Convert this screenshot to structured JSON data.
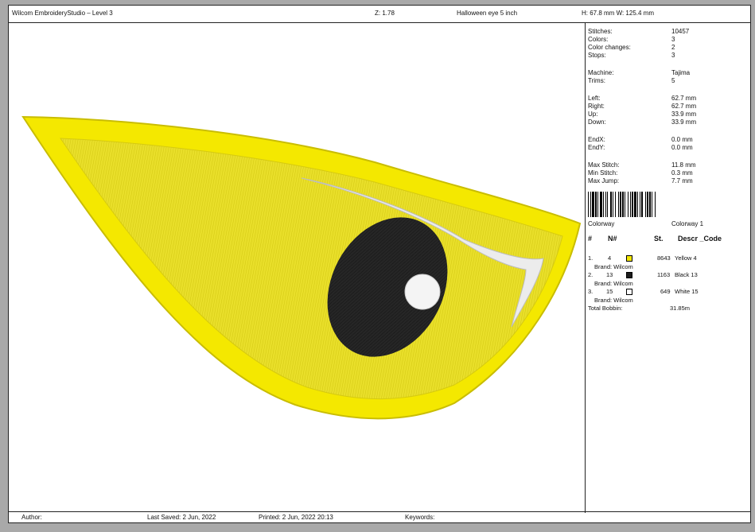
{
  "header": {
    "app_title": "Wilcom EmbroideryStudio – Level 3",
    "zoom": "Z: 1.78",
    "design_name": "Halloween eye 5 inch",
    "dimensions": "H: 67.8 mm  W: 125.4 mm"
  },
  "stats": [
    {
      "label": "Stitches:",
      "value": "10457"
    },
    {
      "label": "Colors:",
      "value": "3"
    },
    {
      "label": "Color changes:",
      "value": "2"
    },
    {
      "label": "Stops:",
      "value": "3"
    },
    {
      "label": "Machine:",
      "value": "Tajima"
    },
    {
      "label": "Trims:",
      "value": "5"
    },
    {
      "label": "Left:",
      "value": "62.7 mm"
    },
    {
      "label": "Right:",
      "value": "62.7 mm"
    },
    {
      "label": "Up:",
      "value": "33.9 mm"
    },
    {
      "label": "Down:",
      "value": "33.9 mm"
    },
    {
      "label": "EndX:",
      "value": "0.0 mm"
    },
    {
      "label": "EndY:",
      "value": "0.0 mm"
    },
    {
      "label": "Max Stitch:",
      "value": "11.8 mm"
    },
    {
      "label": "Min Stitch:",
      "value": "0.3 mm"
    },
    {
      "label": "Max Jump:",
      "value": "7.7 mm"
    }
  ],
  "colorway": {
    "label": "Colorway",
    "value": "Colorway 1"
  },
  "color_table": {
    "headers": {
      "num": "#",
      "n": "N#",
      "st": "St.",
      "desc": "Descr _Code"
    },
    "rows": [
      {
        "index": "1.",
        "n": "4",
        "color": "#f2e600",
        "stitches": "8643",
        "desc": "Yellow 4",
        "brand": "Brand: Wilcom"
      },
      {
        "index": "2.",
        "n": "13",
        "color": "#1c1c1c",
        "stitches": "1163",
        "desc": "Black 13",
        "brand": "Brand: Wilcom"
      },
      {
        "index": "3.",
        "n": "15",
        "color": "#ffffff",
        "stitches": "649",
        "desc": "White 15",
        "brand": "Brand: Wilcom"
      }
    ],
    "total_bobbin_label": "Total Bobbin:",
    "total_bobbin_value": "31.85m"
  },
  "footer": {
    "author": "Author:",
    "last_saved": "Last Saved:  2 Jun, 2022",
    "printed": "Printed:  2 Jun, 2022 20:13",
    "keywords": "Keywords:"
  },
  "colors": {
    "yellow": "#f2e600",
    "yellow_dark": "#c8bd00",
    "black": "#1c1c1c",
    "white": "#ffffff"
  }
}
